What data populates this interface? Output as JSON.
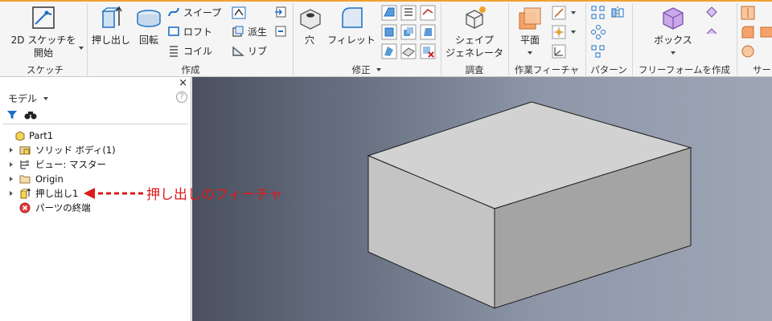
{
  "ribbon": {
    "accent_color": "#f0a030",
    "panels": {
      "sketch": "スケッチ",
      "create": "作成",
      "modify": "修正",
      "explore": "調査",
      "work_features": "作業フィーチャ",
      "pattern": "パターン",
      "freeform": "フリーフォームを作成",
      "surface": "サー"
    },
    "buttons": {
      "start_sketch_line1": "2D スケッチを",
      "start_sketch_line2": "開始",
      "extrude": "押し出し",
      "revolve": "回転",
      "sweep": "スイープ",
      "loft": "ロフト",
      "coil": "コイル",
      "derive": "派生",
      "rib": "リブ",
      "hole": "穴",
      "fillet": "フィレット",
      "shape_gen_line1": "シェイプ",
      "shape_gen_line2": "ジェネレータ",
      "plane": "平面",
      "box": "ボックス"
    }
  },
  "browser": {
    "title": "モデル",
    "help": "?",
    "close": "×",
    "items": [
      {
        "label": "Part1",
        "icon": "part-icon"
      },
      {
        "label": "ソリッド ボディ(1)",
        "icon": "solid-bodies-icon"
      },
      {
        "label": "ビュー: マスター",
        "icon": "view-icon"
      },
      {
        "label": "Origin",
        "icon": "folder-icon"
      },
      {
        "label": "押し出し1",
        "icon": "extrude-feature-icon"
      },
      {
        "label": "パーツの終端",
        "icon": "end-of-part-icon"
      }
    ]
  },
  "annotation": {
    "text": "押し出しのフィーチャ",
    "color": "#e01818"
  }
}
